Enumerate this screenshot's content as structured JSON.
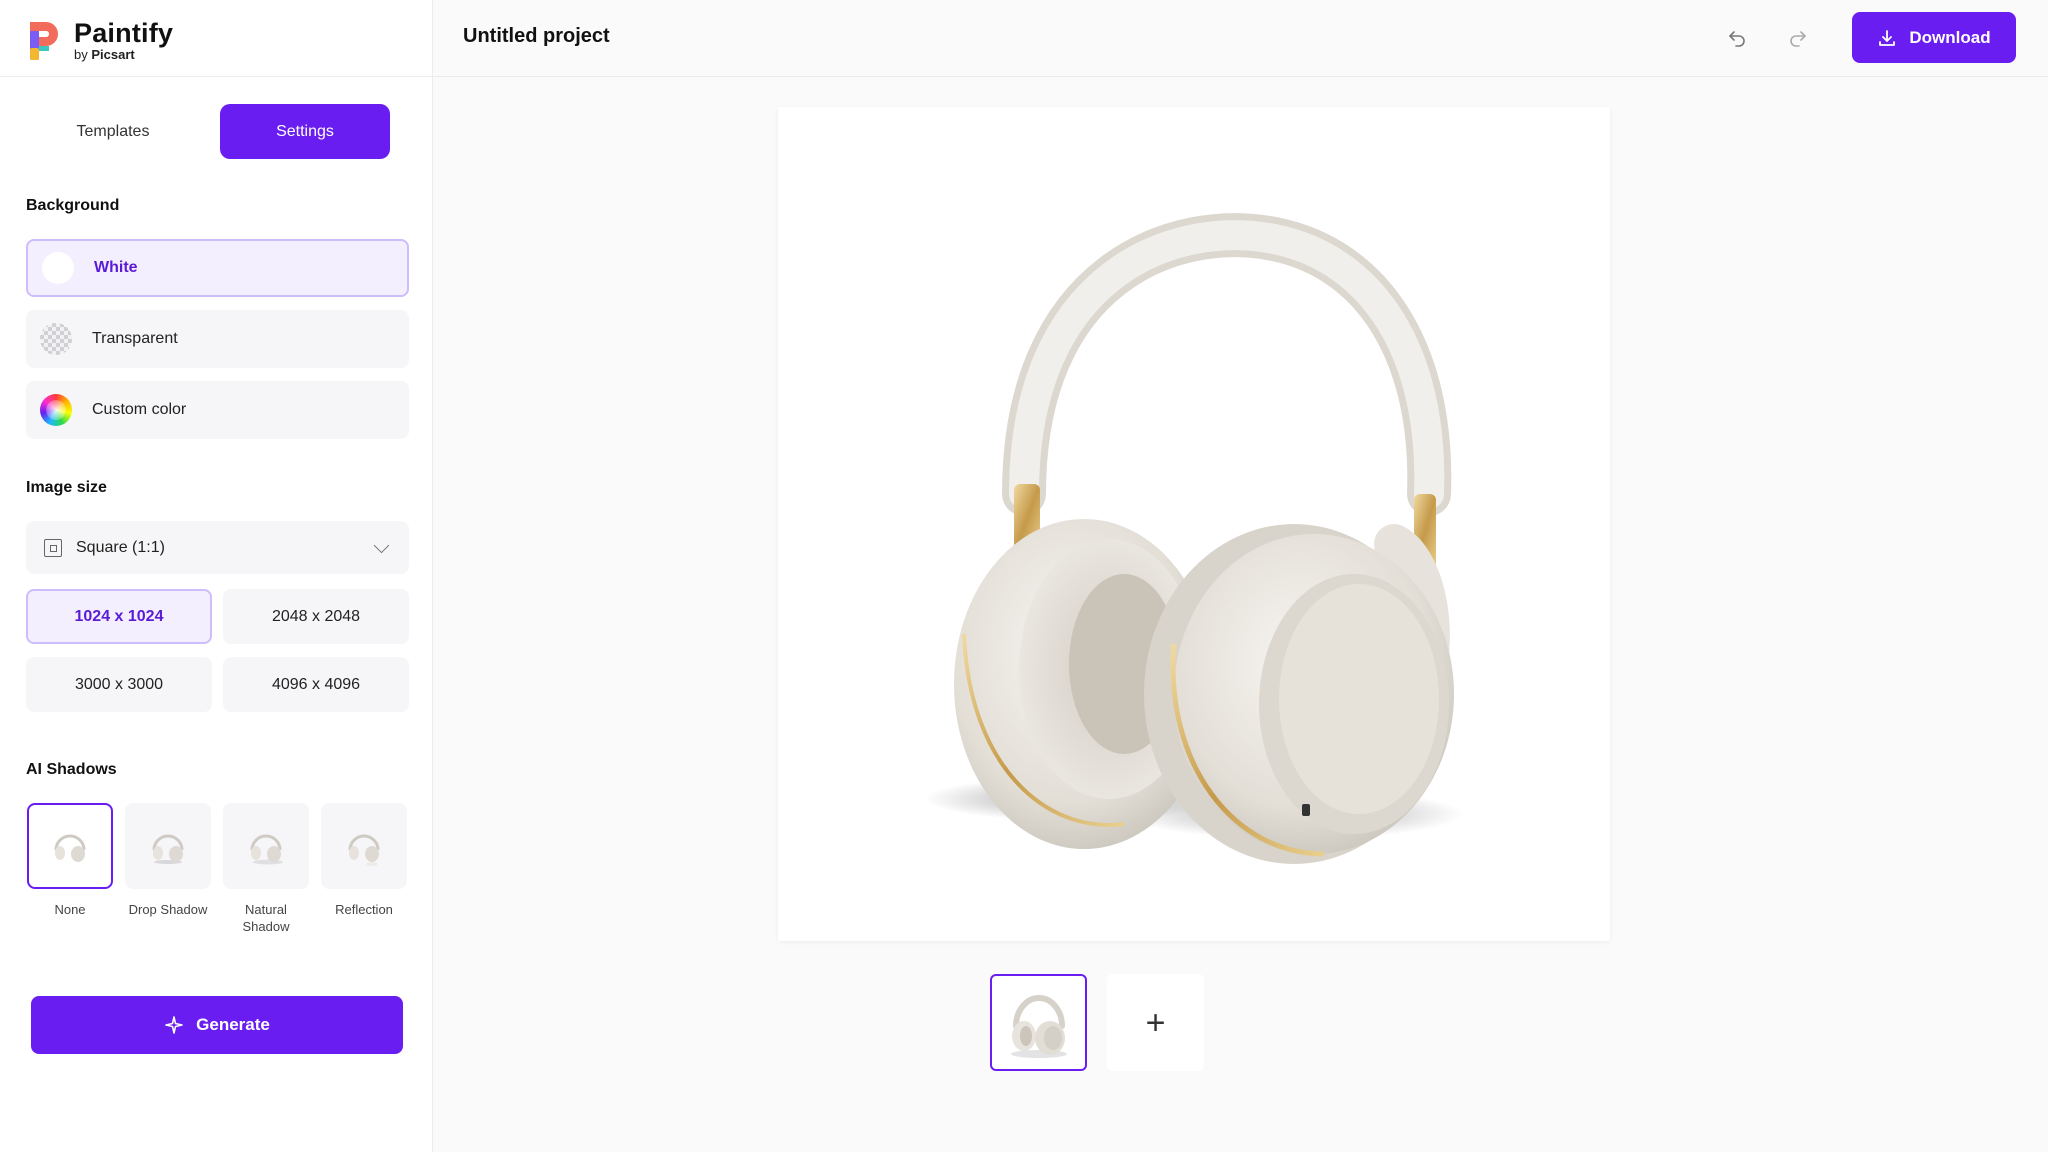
{
  "brand": {
    "name": "Paintify",
    "by": "by",
    "sub": "Picsart"
  },
  "sidebar": {
    "tabs": [
      {
        "label": "Templates",
        "active": false
      },
      {
        "label": "Settings",
        "active": true
      }
    ],
    "background": {
      "title": "Background",
      "options": [
        {
          "label": "White",
          "swatch": "white",
          "selected": true
        },
        {
          "label": "Transparent",
          "swatch": "checker",
          "selected": false
        },
        {
          "label": "Custom color",
          "swatch": "rainbow",
          "selected": false
        }
      ]
    },
    "image_size": {
      "title": "Image size",
      "aspect_selected": "Square (1:1)",
      "sizes": [
        {
          "label": "1024 x 1024",
          "selected": true
        },
        {
          "label": "2048 x 2048",
          "selected": false
        },
        {
          "label": "3000 x 3000",
          "selected": false
        },
        {
          "label": "4096 x 4096",
          "selected": false
        }
      ]
    },
    "ai_shadows": {
      "title": "AI Shadows",
      "options": [
        {
          "label": "None",
          "selected": true
        },
        {
          "label": "Drop Shadow",
          "selected": false
        },
        {
          "label": "Natural Shadow",
          "selected": false
        },
        {
          "label": "Reflection",
          "selected": false
        }
      ]
    },
    "generate_label": "Generate"
  },
  "header": {
    "project_title": "Untitled project",
    "undo_icon": "undo-icon",
    "redo_icon": "redo-icon",
    "download_label": "Download"
  },
  "colors": {
    "accent": "#6a1df0",
    "accent_light": "#f3efff"
  }
}
